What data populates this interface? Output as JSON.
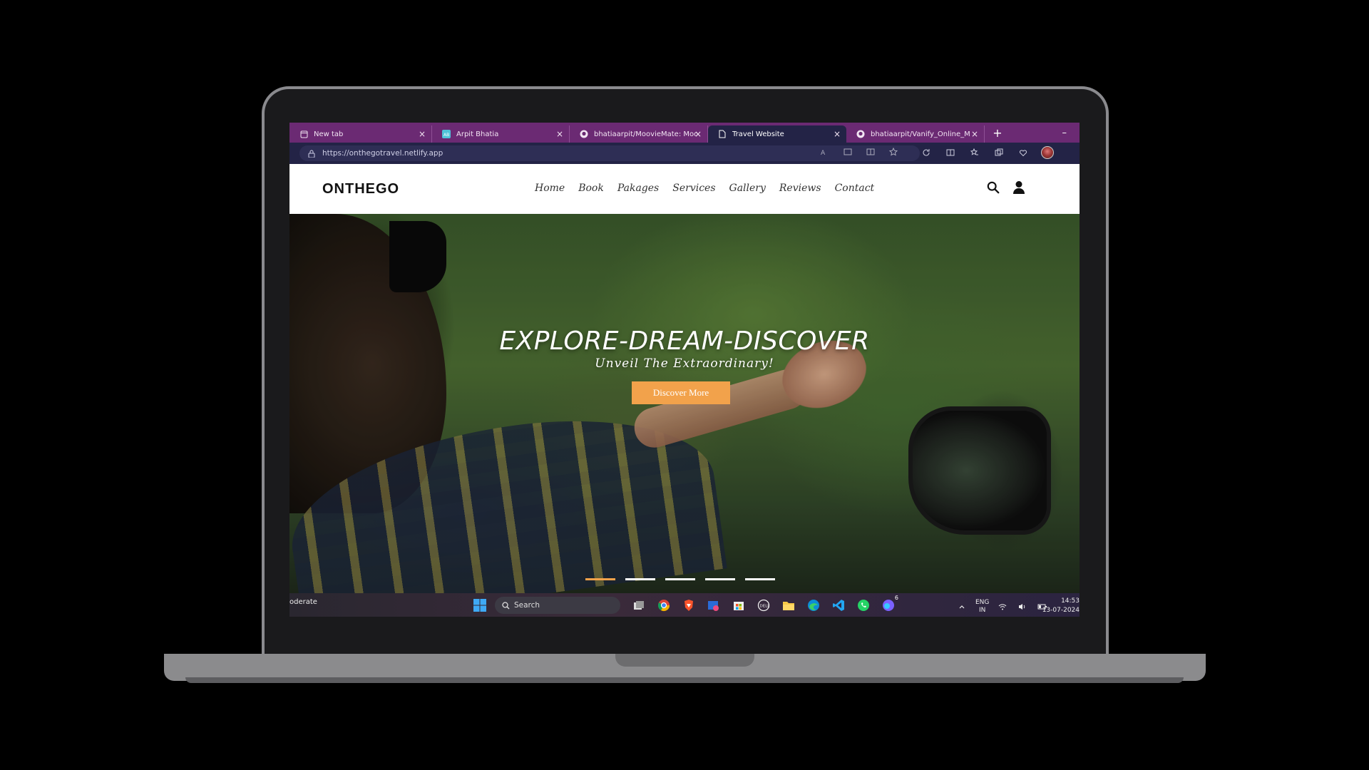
{
  "browser": {
    "tabs": [
      {
        "label": "New tab",
        "icon": "newtab-icon",
        "close": "×"
      },
      {
        "label": "Arpit Bhatia",
        "icon": "site-icon",
        "close": "×"
      },
      {
        "label": "bhatiaarpit/MoovieMate: Moovie",
        "icon": "github-icon",
        "close": "×"
      },
      {
        "label": "Travel Website",
        "icon": "page-icon",
        "close": "×"
      },
      {
        "label": "bhatiaarpit/Vanify_Online_Music",
        "icon": "github-icon",
        "close": "×"
      }
    ],
    "active_tab_index": 3,
    "new_tab": "+",
    "minimize": "–",
    "url": "https://onthegotravel.netlify.app"
  },
  "site": {
    "logo": "ONTHEGO",
    "nav": [
      "Home",
      "Book",
      "Pakages",
      "Services",
      "Gallery",
      "Reviews",
      "Contact"
    ],
    "hero_title": "EXPLORE-DREAM-DISCOVER",
    "hero_subtitle": "Unveil The Extraordinary!",
    "cta_label": "Discover More",
    "slides": 5,
    "active_slide": 0,
    "accent": "#f2a24b"
  },
  "taskbar": {
    "weather_text": "oderate",
    "search_label": "Search",
    "apps": [
      "task-view",
      "chrome",
      "brave",
      "snipping-tool",
      "microsoft-store",
      "dell",
      "file-explorer",
      "edge",
      "vscode",
      "whatsapp",
      "copilot"
    ],
    "copilot_badge": "6",
    "lang_line1": "ENG",
    "lang_line2": "IN",
    "time": "14:53",
    "date": "13-07-2024"
  }
}
